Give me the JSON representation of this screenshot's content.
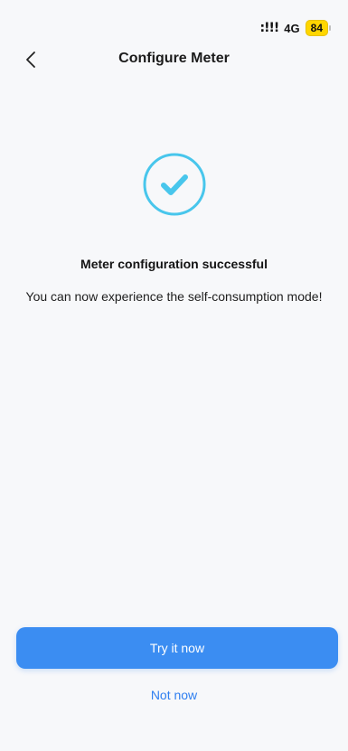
{
  "status": {
    "signal": ":!!!",
    "network": "4G",
    "battery": "84"
  },
  "header": {
    "title": "Configure Meter",
    "back_icon": "chevron-left-icon"
  },
  "result": {
    "icon": "check-circle-icon",
    "accent_color": "#48c6ec",
    "title": "Meter configuration successful",
    "subtitle": "You can now experience the self-consumption mode!"
  },
  "actions": {
    "primary_label": "Try it now",
    "secondary_label": "Not now",
    "primary_color": "#3b8df2"
  }
}
